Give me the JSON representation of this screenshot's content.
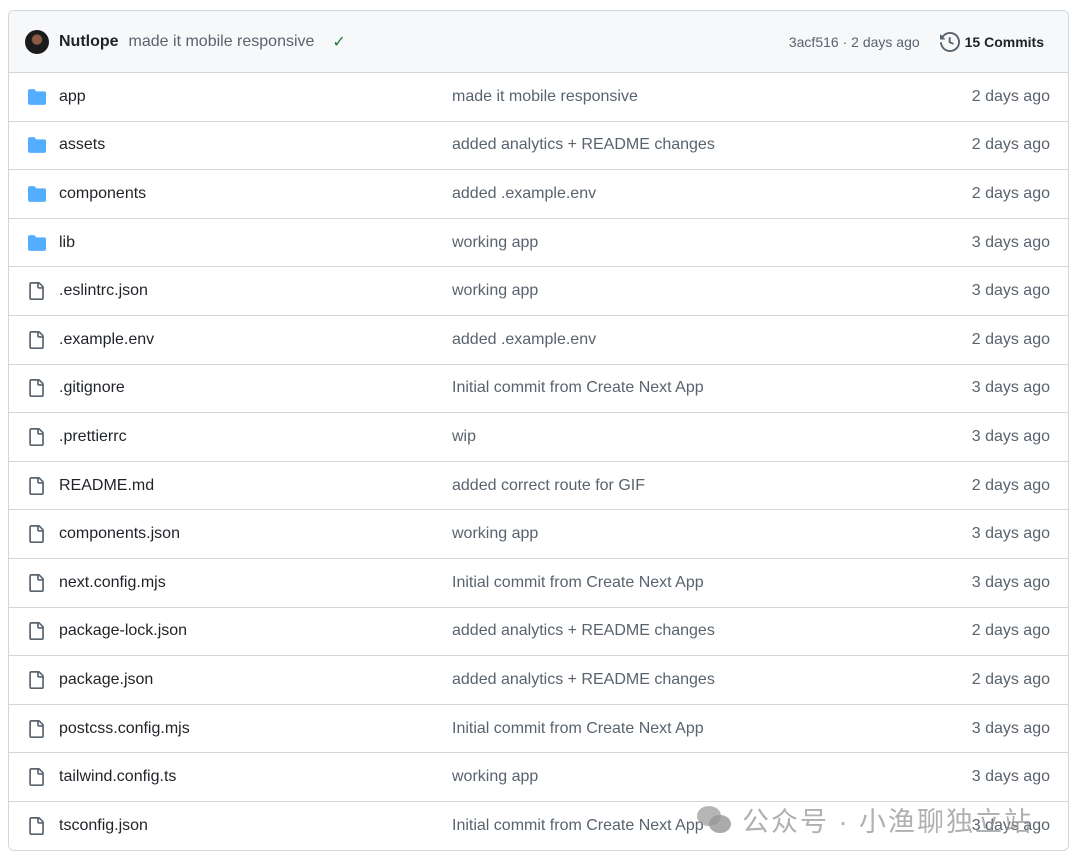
{
  "header": {
    "author": "Nutlope",
    "message": "made it mobile responsive",
    "sha": "3acf516",
    "sha_time": "2 days ago",
    "commits_label": "15 Commits"
  },
  "files": [
    {
      "type": "folder",
      "name": "app",
      "commit": "made it mobile responsive",
      "age": "2 days ago"
    },
    {
      "type": "folder",
      "name": "assets",
      "commit": "added analytics + README changes",
      "age": "2 days ago"
    },
    {
      "type": "folder",
      "name": "components",
      "commit": "added .example.env",
      "age": "2 days ago"
    },
    {
      "type": "folder",
      "name": "lib",
      "commit": "working app",
      "age": "3 days ago"
    },
    {
      "type": "file",
      "name": ".eslintrc.json",
      "commit": "working app",
      "age": "3 days ago"
    },
    {
      "type": "file",
      "name": ".example.env",
      "commit": "added .example.env",
      "age": "2 days ago"
    },
    {
      "type": "file",
      "name": ".gitignore",
      "commit": "Initial commit from Create Next App",
      "age": "3 days ago"
    },
    {
      "type": "file",
      "name": ".prettierrc",
      "commit": "wip",
      "age": "3 days ago"
    },
    {
      "type": "file",
      "name": "README.md",
      "commit": "added correct route for GIF",
      "age": "2 days ago"
    },
    {
      "type": "file",
      "name": "components.json",
      "commit": "working app",
      "age": "3 days ago"
    },
    {
      "type": "file",
      "name": "next.config.mjs",
      "commit": "Initial commit from Create Next App",
      "age": "3 days ago"
    },
    {
      "type": "file",
      "name": "package-lock.json",
      "commit": "added analytics + README changes",
      "age": "2 days ago"
    },
    {
      "type": "file",
      "name": "package.json",
      "commit": "added analytics + README changes",
      "age": "2 days ago"
    },
    {
      "type": "file",
      "name": "postcss.config.mjs",
      "commit": "Initial commit from Create Next App",
      "age": "3 days ago"
    },
    {
      "type": "file",
      "name": "tailwind.config.ts",
      "commit": "working app",
      "age": "3 days ago"
    },
    {
      "type": "file",
      "name": "tsconfig.json",
      "commit": "Initial commit from Create Next App",
      "age": "3 days ago"
    }
  ],
  "watermark": "公众号 · 小渔聊独立站",
  "colors": {
    "folder": "#54aeff",
    "check": "#1a7f37",
    "border": "#d0d7de"
  }
}
